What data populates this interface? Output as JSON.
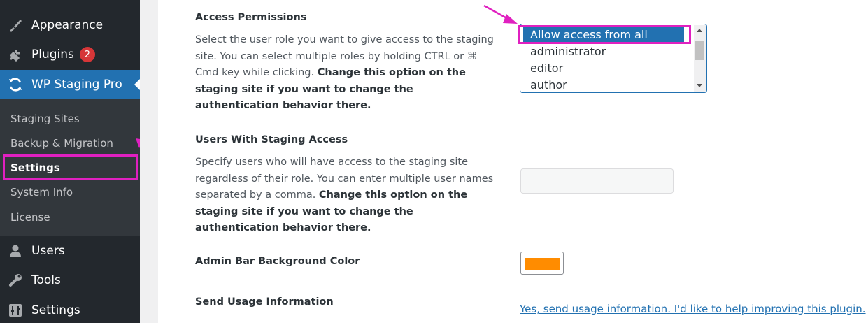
{
  "sidebar": {
    "items_top": [
      {
        "label": "Appearance",
        "icon": "paintbrush-icon"
      },
      {
        "label": "Plugins",
        "icon": "plugin-icon",
        "badge": "2"
      },
      {
        "label": "WP Staging Pro",
        "icon": "refresh-icon",
        "active": true
      }
    ],
    "submenu": [
      {
        "label": "Staging Sites"
      },
      {
        "label": "Backup & Migration"
      },
      {
        "label": "Settings",
        "current": true
      },
      {
        "label": "System Info"
      },
      {
        "label": "License"
      }
    ],
    "items_bottom": [
      {
        "label": "Users",
        "icon": "user-icon"
      },
      {
        "label": "Tools",
        "icon": "wrench-icon"
      },
      {
        "label": "Settings",
        "icon": "sliders-icon"
      }
    ]
  },
  "settings": {
    "access_permissions": {
      "label": "Access Permissions",
      "desc_plain": "Select the user role you want to give access to the staging site. You can select multiple roles by holding CTRL or ⌘ Cmd key while clicking. ",
      "desc_bold": "Change this option on the staging site if you want to change the authentication behavior there.",
      "options": [
        "Allow access from all visitors",
        "administrator",
        "editor",
        "author"
      ],
      "selected": "Allow access from all visitors"
    },
    "users_with_access": {
      "label": "Users With Staging Access",
      "desc_plain": "Specify users who will have access to the staging site regardless of their role. You can enter multiple user names separated by a comma. ",
      "desc_bold": "Change this option on the staging site if you want to change the authentication behavior there.",
      "value": ""
    },
    "admin_bar_color": {
      "label": "Admin Bar Background Color",
      "color": "#ff8c00"
    },
    "usage_info": {
      "label": "Send Usage Information",
      "link_text": "Yes, send usage information. I'd like to help improving this plugin."
    }
  },
  "colors": {
    "sidebar_bg": "#23282d",
    "submenu_bg": "#32373c",
    "accent": "#2271b1",
    "highlight": "#e020c0",
    "badge": "#d63638"
  }
}
